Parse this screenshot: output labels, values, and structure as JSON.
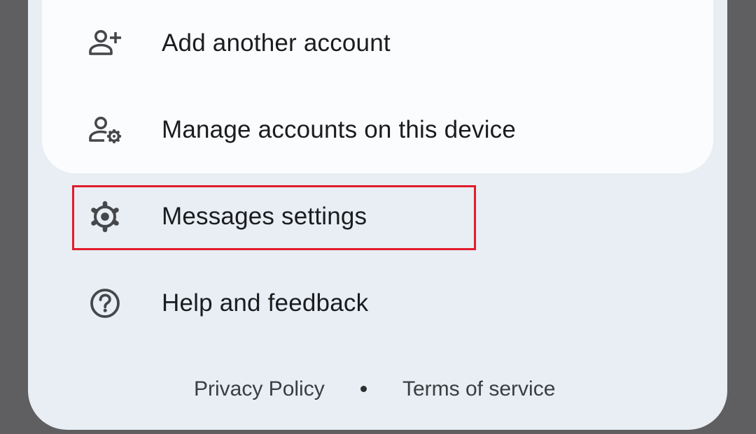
{
  "menu": {
    "add_account": {
      "label": "Add another account",
      "icon": "person-add-icon"
    },
    "manage_accounts": {
      "label": "Manage accounts on this device",
      "icon": "manage-accounts-icon"
    },
    "messages_settings": {
      "label": "Messages settings",
      "icon": "gear-icon"
    },
    "help_feedback": {
      "label": "Help and feedback",
      "icon": "help-circle-icon"
    }
  },
  "footer": {
    "privacy_policy": "Privacy Policy",
    "separator": "•",
    "terms_of_service": "Terms of service"
  },
  "colors": {
    "scrim": "#5f5f61",
    "sheet": "#e8eef3",
    "card": "#fbfcfe",
    "text": "#1b1c1f",
    "icon": "#45474a",
    "highlight": "#e11b2b"
  }
}
